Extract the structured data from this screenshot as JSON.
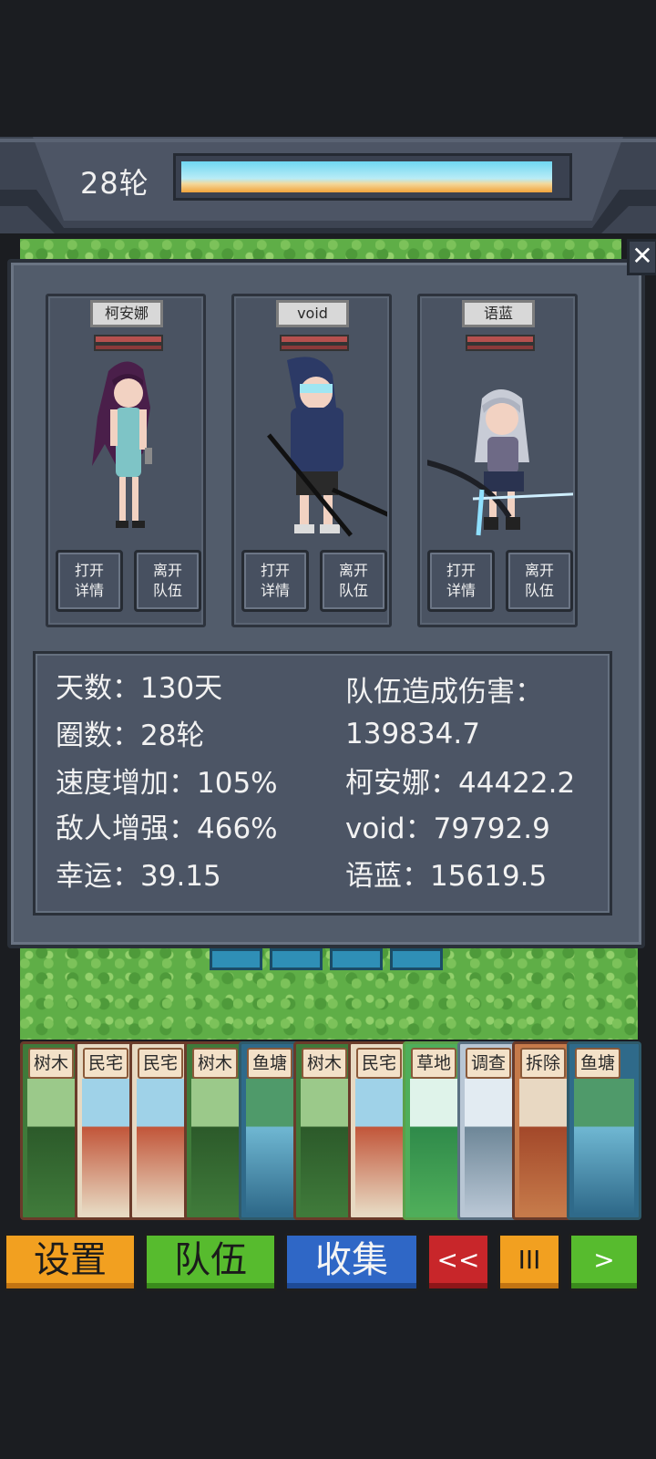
{
  "hud": {
    "round_label": "28轮",
    "progress_fraction": 0.97
  },
  "members": [
    {
      "name": "柯安娜",
      "detail_line1": "打开",
      "detail_line2": "详情",
      "leave_line1": "离开",
      "leave_line2": "队伍"
    },
    {
      "name": "void",
      "detail_line1": "打开",
      "detail_line2": "详情",
      "leave_line1": "离开",
      "leave_line2": "队伍"
    },
    {
      "name": "语蓝",
      "detail_line1": "打开",
      "detail_line2": "详情",
      "leave_line1": "离开",
      "leave_line2": "队伍"
    }
  ],
  "close_label": "✕",
  "stats": {
    "days": "天数：130天",
    "laps": "圈数：28轮",
    "speed": "速度增加：105%",
    "enemy": "敌人增强：466%",
    "luck": "幸运：39.15",
    "team_damage_label": "队伍造成伤害：",
    "team_damage_value": "139834.7",
    "damage_1": "柯安娜：44422.2",
    "damage_2": "void：79792.9",
    "damage_3": "语蓝：15619.5"
  },
  "cards": [
    {
      "title": "树木",
      "kind": "tree"
    },
    {
      "title": "民宅",
      "kind": "house"
    },
    {
      "title": "民宅",
      "kind": "house"
    },
    {
      "title": "树木",
      "kind": "tree"
    },
    {
      "title": "鱼塘",
      "kind": "pond"
    },
    {
      "title": "树木",
      "kind": "tree"
    },
    {
      "title": "民宅",
      "kind": "house"
    },
    {
      "title": "草地",
      "kind": "grass"
    },
    {
      "title": "调查",
      "kind": "search"
    },
    {
      "title": "拆除",
      "kind": "demolish"
    },
    {
      "title": "鱼塘",
      "kind": "pond"
    }
  ],
  "bottom_bar": {
    "settings": "设置",
    "team": "队伍",
    "collect": "收集",
    "rewind": "<<",
    "pause": "III",
    "play": ">"
  },
  "colors": {
    "dialog": "#525c6b",
    "accent_orange": "#f2a020",
    "accent_green": "#57bb2e",
    "accent_blue": "#2f67c6",
    "accent_red": "#c8262a"
  }
}
